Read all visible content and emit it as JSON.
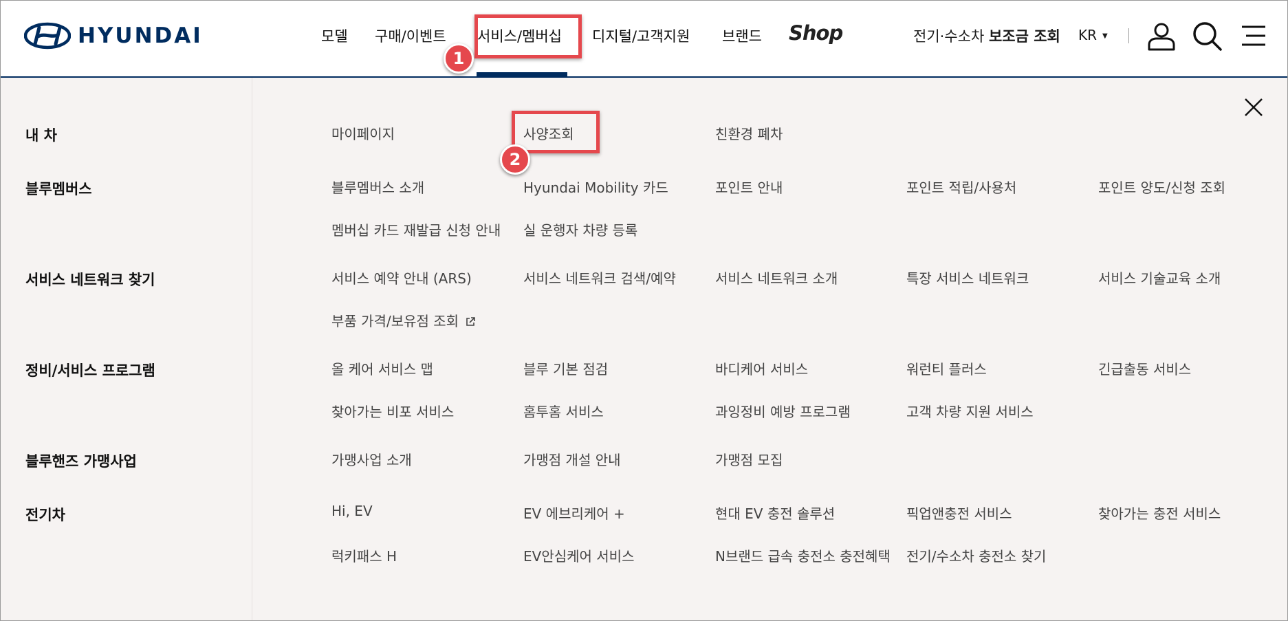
{
  "brand": {
    "logo_text": "HYUNDAI",
    "color": "#002c5f"
  },
  "gnb": {
    "items": [
      "모델",
      "구매/이벤트",
      "서비스/멤버십",
      "디지털/고객지원",
      "브랜드"
    ],
    "shop_label": "Shop",
    "active_index": 2
  },
  "utility": {
    "subsidy_prefix": "전기·수소차 ",
    "subsidy_bold": "보조금 조회",
    "lang": "KR"
  },
  "annotations": [
    {
      "number": "1",
      "target": "서비스/멤버십"
    },
    {
      "number": "2",
      "target": "사양조회"
    }
  ],
  "menu": {
    "sections": [
      {
        "title": "내 차",
        "links": [
          "마이페이지",
          "사양조회",
          "친환경 폐차"
        ]
      },
      {
        "title": "블루멤버스",
        "links": [
          "블루멤버스 소개",
          "Hyundai Mobility 카드",
          "포인트 안내",
          "포인트 적립/사용처",
          "포인트 양도/신청 조회",
          "멤버십 카드 재발급 신청 안내",
          "실 운행자 차량 등록"
        ]
      },
      {
        "title": "서비스 네트워크 찾기",
        "links": [
          "서비스 예약 안내 (ARS)",
          "서비스 네트워크 검색/예약",
          "서비스 네트워크 소개",
          "특장 서비스 네트워크",
          "서비스 기술교육 소개",
          "부품 가격/보유점 조회"
        ]
      },
      {
        "title": "정비/서비스 프로그램",
        "links": [
          "올 케어 서비스 맵",
          "블루 기본 점검",
          "바디케어 서비스",
          "워런티 플러스",
          "긴급출동 서비스",
          "찾아가는 비포 서비스",
          "홈투홈 서비스",
          "과잉정비 예방 프로그램",
          "고객 차량 지원 서비스"
        ]
      },
      {
        "title": "블루핸즈 가맹사업",
        "links": [
          "가맹사업 소개",
          "가맹점 개설 안내",
          "가맹점 모집"
        ]
      },
      {
        "title": "전기차",
        "links": [
          "Hi, EV",
          "EV 에브리케어 +",
          "현대 EV 충전 솔루션",
          "픽업앤충전 서비스",
          "찾아가는 충전 서비스",
          "럭키패스 H",
          "EV안심케어 서비스",
          "N브랜드 급속 충전소 충전혜택",
          "전기/수소차 충전소 찾기"
        ]
      }
    ]
  }
}
